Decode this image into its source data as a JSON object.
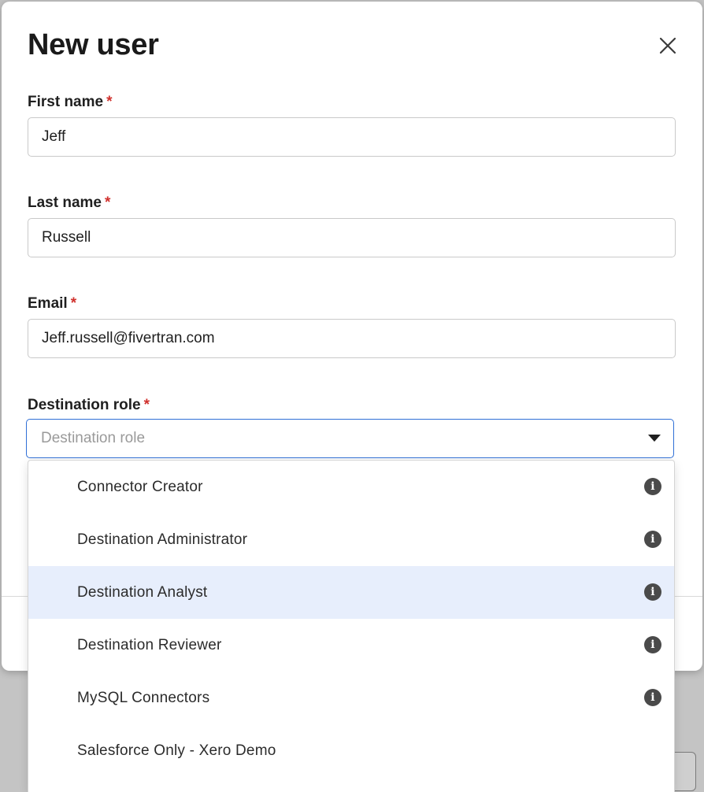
{
  "modal": {
    "title": "New user",
    "close_icon": "close-icon"
  },
  "fields": {
    "first_name": {
      "label": "First name",
      "required": "*",
      "value": "Jeff"
    },
    "last_name": {
      "label": "Last name",
      "required": "*",
      "value": "Russell"
    },
    "email": {
      "label": "Email",
      "required": "*",
      "value": "Jeff.russell@fivertran.com"
    },
    "destination_role": {
      "label": "Destination role",
      "required": "*",
      "placeholder": "Destination role"
    }
  },
  "dropdown": {
    "options": [
      {
        "label": "Connector Creator",
        "info_icon": "info-icon",
        "highlighted": false
      },
      {
        "label": "Destination Administrator",
        "info_icon": "info-icon",
        "highlighted": false
      },
      {
        "label": "Destination Analyst",
        "info_icon": "info-icon",
        "highlighted": true
      },
      {
        "label": "Destination Reviewer",
        "info_icon": "info-icon",
        "highlighted": false
      },
      {
        "label": "MySQL Connectors",
        "info_icon": "info-icon",
        "highlighted": false
      },
      {
        "label": "Salesforce Only - Xero Demo",
        "info_icon": null,
        "highlighted": false
      }
    ]
  },
  "colors": {
    "required": "#d0312d",
    "focus_border": "#2f6fd6",
    "highlight": "#e7eefc"
  }
}
